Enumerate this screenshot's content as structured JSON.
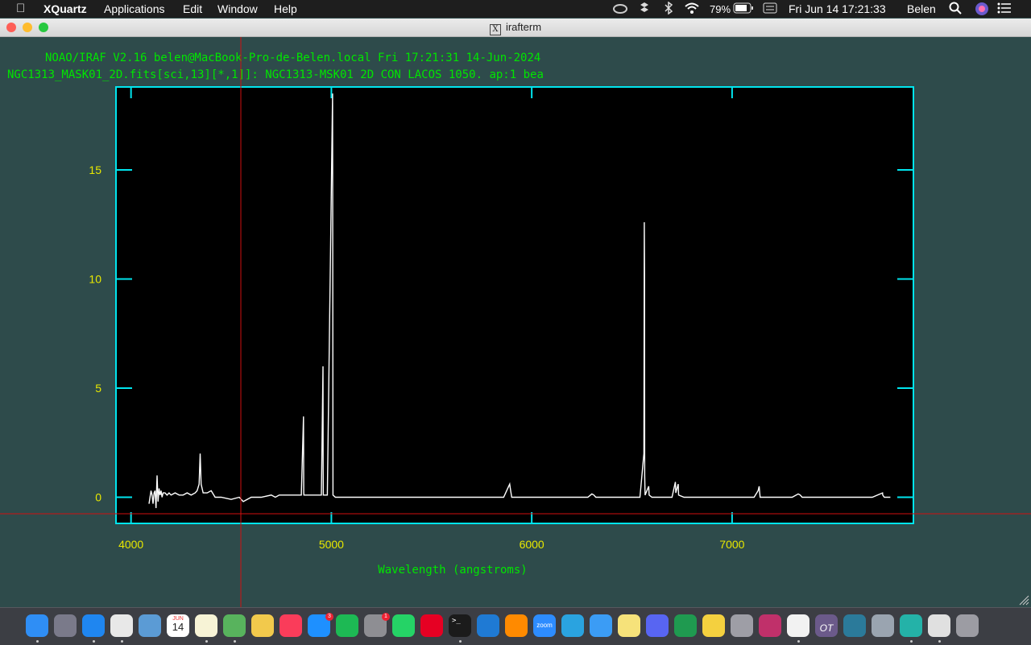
{
  "menubar": {
    "app_name": "XQuartz",
    "menus": [
      "Applications",
      "Edit",
      "Window",
      "Help"
    ],
    "battery": "79%",
    "clock": "Fri Jun 14  17:21:33",
    "user": "Belen"
  },
  "window": {
    "title": "irafterm"
  },
  "terminal": {
    "header_line1": "NOAO/IRAF V2.16 belen@MacBook-Pro-de-Belen.local Fri 17:21:31 14-Jun-2024",
    "header_line2": "NGC1313_MASK01_2D.fits[sci,13][*,1]]: NGC1313-MSK01 2D CON LACOS 1050. ap:1 bea"
  },
  "colors": {
    "frame": "#00e5ee",
    "labels": "#e8e800",
    "header": "#00e600",
    "cursor": "#d01010",
    "spectrum": "#ffffff"
  },
  "chart_data": {
    "type": "line",
    "title": "",
    "xlabel": "Wavelength (angstroms)",
    "ylabel": "",
    "xlim": [
      3925,
      7905
    ],
    "ylim": [
      -1.2,
      18.8
    ],
    "xticks": [
      4000,
      5000,
      6000,
      7000
    ],
    "yticks": [
      0,
      5,
      10,
      15
    ],
    "grid": false,
    "series": [
      {
        "x": [
          4090,
          4100,
          4105,
          4110,
          4115,
          4120,
          4125,
          4130,
          4135,
          4140,
          4145,
          4150,
          4155,
          4160,
          4170,
          4180,
          4190,
          4200,
          4220,
          4240,
          4260,
          4280,
          4300,
          4320,
          4330,
          4340,
          4345,
          4350,
          4360,
          4380,
          4400,
          4420,
          4450,
          4500,
          4540,
          4560,
          4600,
          4650,
          4700,
          4720,
          4740,
          4800,
          4850,
          4861,
          4862,
          4863,
          4880,
          4950,
          4958,
          4959,
          4960,
          4980,
          5006,
          5007,
          5008,
          5020,
          5100,
          5200,
          5300,
          5400,
          5500,
          5600,
          5700,
          5800,
          5860,
          5880,
          5890,
          5895,
          5900,
          5920,
          6000,
          6100,
          6200,
          6280,
          6300,
          6310,
          6320,
          6400,
          6500,
          6540,
          6560,
          6562,
          6563,
          6564,
          6566,
          6584,
          6586,
          6600,
          6640,
          6700,
          6717,
          6719,
          6731,
          6733,
          6760,
          6900,
          7000,
          7110,
          7130,
          7135,
          7138,
          7140,
          7150,
          7300,
          7330,
          7340,
          7350,
          7500,
          7600,
          7700,
          7751,
          7752,
          7760,
          7790
        ],
        "y": [
          -0.3,
          0.3,
          0.1,
          -0.3,
          0.2,
          0.3,
          -0.5,
          1.0,
          -0.2,
          0.4,
          0.1,
          0.3,
          0.0,
          0.2,
          0.2,
          0.1,
          0.2,
          0.1,
          0.2,
          0.1,
          0.1,
          0.2,
          0.1,
          0.2,
          0.3,
          0.6,
          2.0,
          0.6,
          0.2,
          0.2,
          0.3,
          0.0,
          0.0,
          -0.1,
          0.0,
          -0.2,
          0.0,
          0.0,
          0.1,
          0.0,
          0.1,
          0.1,
          0.1,
          3.7,
          0.2,
          0.1,
          0.1,
          0.1,
          6.0,
          1.3,
          0.1,
          0.1,
          18.5,
          12.2,
          0.1,
          0.0,
          0.0,
          0.0,
          0.0,
          0.0,
          0.0,
          0.0,
          0.0,
          0.0,
          0.0,
          0.4,
          0.6,
          0.3,
          0.0,
          0.0,
          0.0,
          0.0,
          0.0,
          0.0,
          0.15,
          0.1,
          0.0,
          0.0,
          0.0,
          0.0,
          2.0,
          12.6,
          10.3,
          1.0,
          0.1,
          0.5,
          0.1,
          0.0,
          0.0,
          0.0,
          0.7,
          0.2,
          0.6,
          0.1,
          0.0,
          0.0,
          0.0,
          0.0,
          0.3,
          0.5,
          0.2,
          0.0,
          0.0,
          0.0,
          0.15,
          0.1,
          0.0,
          0.0,
          0.0,
          0.0,
          0.2,
          0.1,
          0.0,
          0.0
        ]
      }
    ]
  },
  "dock": {
    "icons": [
      "finder-icon",
      "launchpad-icon",
      "safari-icon",
      "chrome-icon",
      "preview-icon",
      "calendar-icon",
      "notes-icon",
      "maps-icon",
      "photos-icon",
      "music-icon",
      "appstore-icon",
      "spotify-icon",
      "settings-icon",
      "whatsapp-icon",
      "pinterest-icon",
      "terminal-icon",
      "vscode-icon",
      "sublime-icon",
      "zoom-icon",
      "telegram-icon",
      "messages-icon",
      "stickies-icon",
      "discord-icon",
      "cleaner-icon",
      "cat-icon",
      "calculator-icon",
      "galaxy-icon",
      "textedit-icon",
      "ot-icon",
      "telescope-icon",
      "screenshot-icon",
      "brain-icon",
      "xquartz-icon",
      "trash-icon"
    ],
    "calendar_date": "14",
    "calendar_month": "JUN",
    "appstore_badge": "3",
    "settings_badge": "1",
    "zoom_label": "zoom",
    "ot_label": "OT"
  }
}
